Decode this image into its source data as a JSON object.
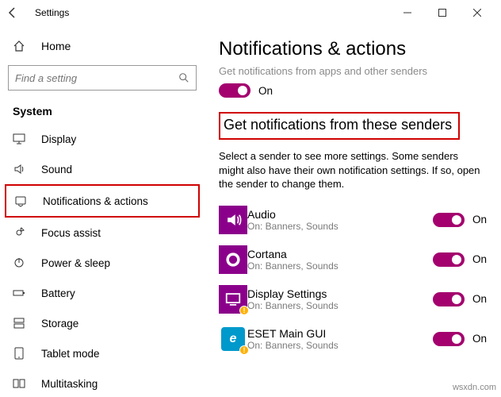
{
  "window": {
    "title": "Settings"
  },
  "sidebar": {
    "home": "Home",
    "search_placeholder": "Find a setting",
    "section": "System",
    "items": [
      {
        "icon": "display",
        "label": "Display"
      },
      {
        "icon": "sound",
        "label": "Sound"
      },
      {
        "icon": "notifications",
        "label": "Notifications & actions",
        "highlighted": true
      },
      {
        "icon": "focus",
        "label": "Focus assist"
      },
      {
        "icon": "power",
        "label": "Power & sleep"
      },
      {
        "icon": "battery",
        "label": "Battery"
      },
      {
        "icon": "storage",
        "label": "Storage"
      },
      {
        "icon": "tablet",
        "label": "Tablet mode"
      },
      {
        "icon": "multitask",
        "label": "Multitasking"
      }
    ]
  },
  "main": {
    "heading": "Notifications & actions",
    "prev_line": "Get notifications from apps and other senders",
    "master_on": "On",
    "section_title": "Get notifications from these senders",
    "description": "Select a sender to see more settings. Some senders might also have their own notification settings. If so, open the sender to change them.",
    "senders": [
      {
        "name": "Audio",
        "sub": "On: Banners, Sounds",
        "state": "On",
        "icon": "audio"
      },
      {
        "name": "Cortana",
        "sub": "On: Banners, Sounds",
        "state": "On",
        "icon": "cortana"
      },
      {
        "name": "Display Settings",
        "sub": "On: Banners, Sounds",
        "state": "On",
        "icon": "display-settings"
      },
      {
        "name": "ESET Main GUI",
        "sub": "On: Banners, Sounds",
        "state": "On",
        "icon": "eset"
      }
    ]
  },
  "watermark": "wsxdn.com"
}
